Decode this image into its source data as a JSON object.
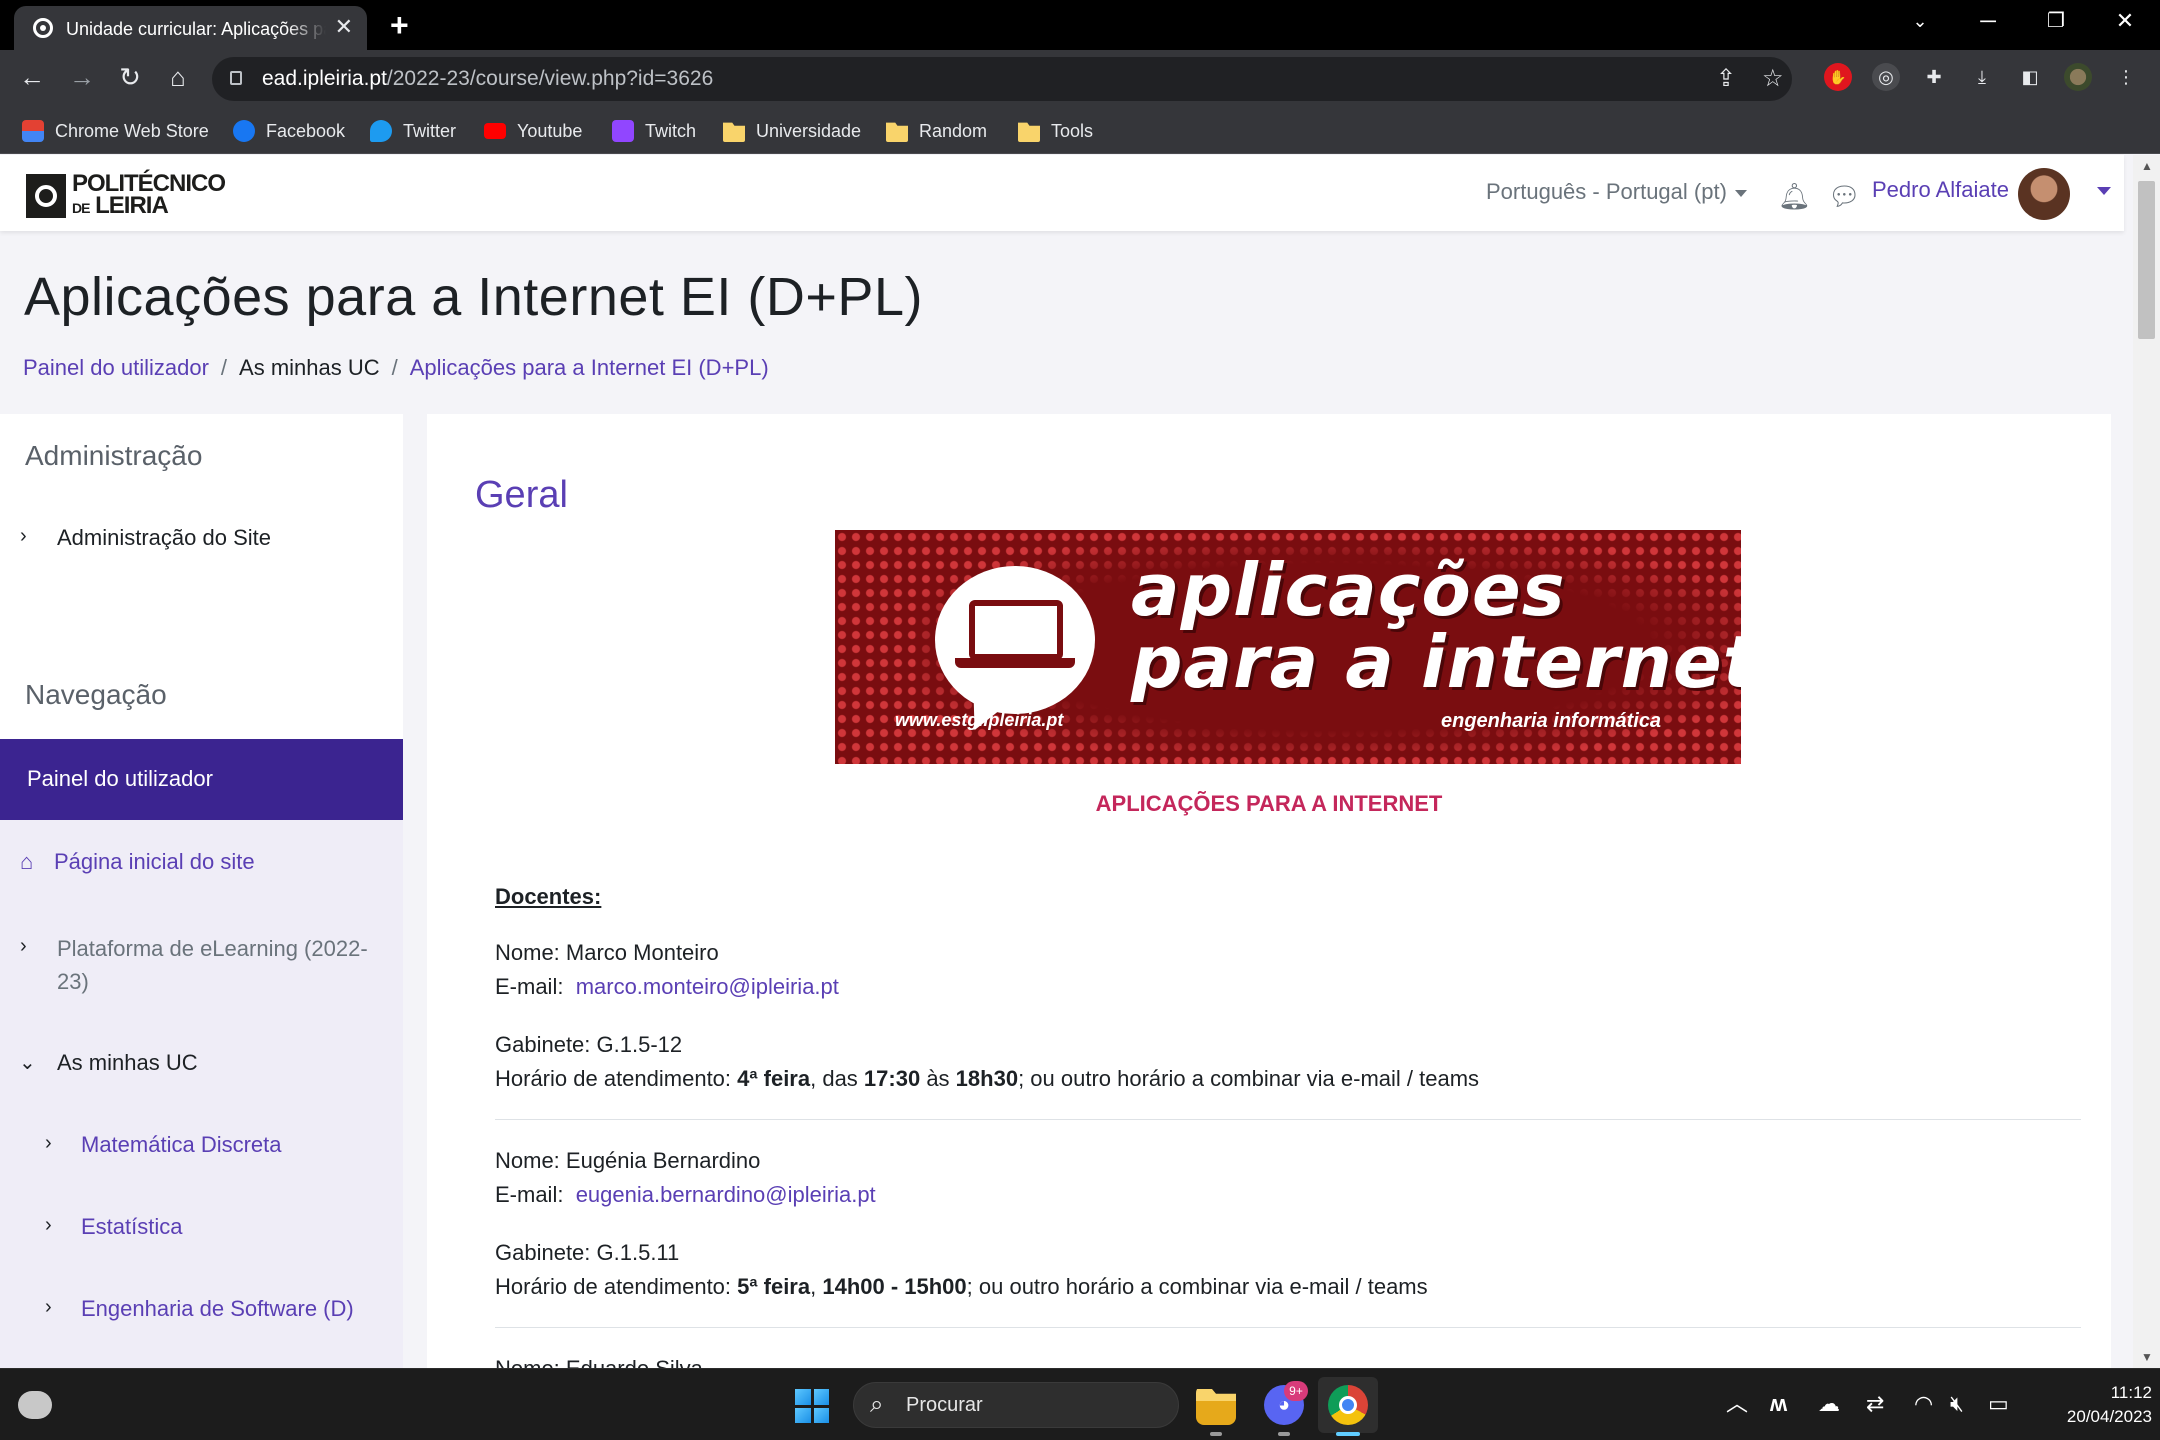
{
  "browser": {
    "tab_title": "Unidade curricular: Aplicações para a Internet EI (D+PL)",
    "url_host": "ead.ipleiria.pt",
    "url_path": "/2022-23/course/view.php?id=3626",
    "bookmarks": [
      {
        "label": "Chrome Web Store",
        "icon": "chrome-web-store-icon",
        "color": "#e34133"
      },
      {
        "label": "Facebook",
        "icon": "facebook-icon",
        "color": "#1877f2"
      },
      {
        "label": "Twitter",
        "icon": "twitter-icon",
        "color": "#1d9bf0"
      },
      {
        "label": "Youtube",
        "icon": "youtube-icon",
        "color": "#ff0000"
      },
      {
        "label": "Twitch",
        "icon": "twitch-icon",
        "color": "#9146ff"
      },
      {
        "label": "Universidade",
        "icon": "folder-icon",
        "color": "#f9d46b"
      },
      {
        "label": "Random",
        "icon": "folder-icon",
        "color": "#f9d46b"
      },
      {
        "label": "Tools",
        "icon": "folder-icon",
        "color": "#f9d46b"
      }
    ]
  },
  "header": {
    "logo_line1": "POLITÉCNICO",
    "logo_de": "DE",
    "logo_line2": "LEIRIA",
    "language": "Português - Portugal (pt)",
    "user_name": "Pedro Alfaiate"
  },
  "page": {
    "title": "Aplicações para a Internet EI (D+PL)",
    "breadcrumb": [
      "Painel do utilizador",
      "As minhas UC",
      "Aplicações para a Internet EI (D+PL)"
    ]
  },
  "sidebar": {
    "admin_heading": "Administração",
    "admin_item": "Administração do Site",
    "nav_heading": "Navegação",
    "active_item": "Painel do utilizador",
    "home_item": "Página inicial do site",
    "platform_item_line1": "Plataforma de eLearning (2022-",
    "platform_item_line2": "23)",
    "my_courses": "As minhas UC",
    "courses": [
      "Matemática Discreta",
      "Estatística",
      "Engenharia de Software (D)"
    ]
  },
  "main": {
    "section_title": "Geral",
    "banner": {
      "line1": "aplicações",
      "line2": "para a internet",
      "site": "www.estg.ipleiria.pt",
      "subtitle": "engenharia informática"
    },
    "course_title": "APLICAÇÕES PARA A INTERNET",
    "docentes_label": "Docentes:",
    "prof1": {
      "name": "Nome: Marco Monteiro",
      "email_label": "E-mail:",
      "email": "marco.monteiro@ipleiria.pt",
      "office": "Gabinete: G.1.5-12",
      "hours_label": "Horário de atendimento: ",
      "day": "4ª feira",
      "t_a": ", das ",
      "start": "17:30",
      "t_b": " às ",
      "end": "18h30",
      "t_c": "; ou outro horário a combinar via e-mail / teams"
    },
    "prof2": {
      "name": "Nome: Eugénia Bernardino",
      "email_label": "E-mail:",
      "email": "eugenia.bernardino@ipleiria.pt",
      "office": "Gabinete: G.1.5.11",
      "hours_label": "Horário de atendimento: ",
      "day": "5ª feira",
      "t_a": ", ",
      "slot": "14h00 - 15h00",
      "t_c": "; ou outro horário a combinar via e-mail / teams"
    },
    "prof3_partial": "Nome: Eduardo Silva"
  },
  "taskbar": {
    "search_label": "Procurar",
    "discord_badge": "9+",
    "time": "11:12",
    "date": "20/04/2023"
  }
}
